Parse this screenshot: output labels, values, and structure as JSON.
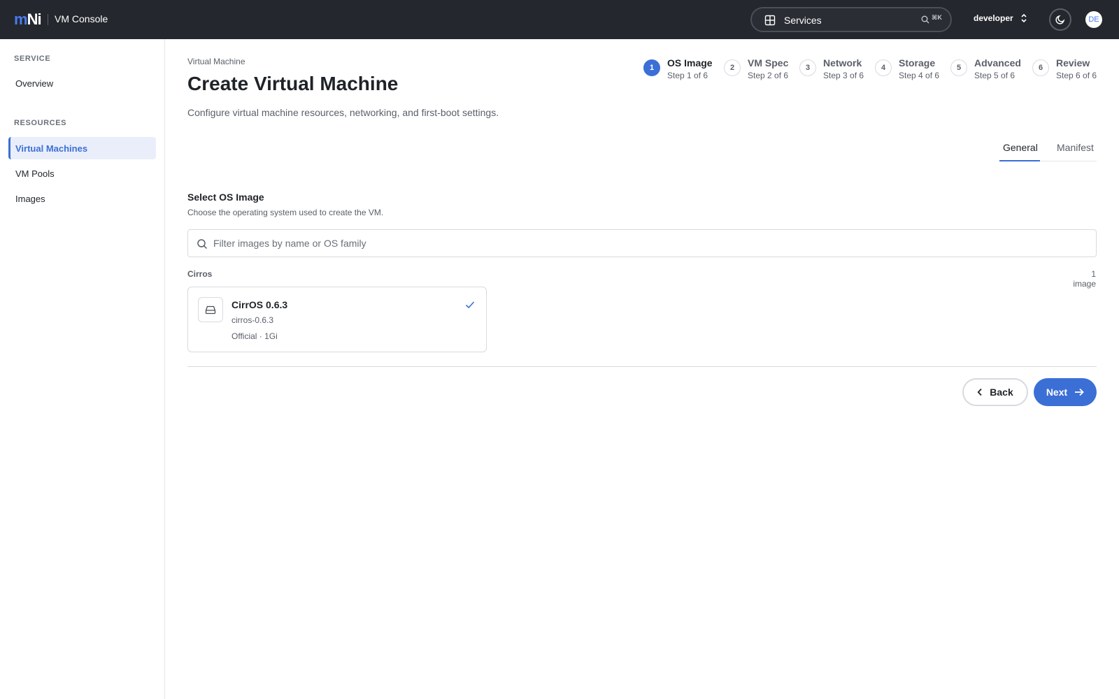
{
  "header": {
    "logo_m": "m",
    "logo_ni": "Ni",
    "app_title": "VM Console",
    "services_label": "Services",
    "shortcut": "⌘K",
    "project": "developer",
    "avatar_initials": "DE",
    "brand_color": "#4a7bf0"
  },
  "sidebar": {
    "sections": [
      {
        "title": "SERVICE",
        "items": [
          {
            "label": "Overview",
            "active": false
          }
        ]
      },
      {
        "title": "RESOURCES",
        "items": [
          {
            "label": "Virtual Machines",
            "active": true
          },
          {
            "label": "VM Pools",
            "active": false
          },
          {
            "label": "Images",
            "active": false
          }
        ]
      }
    ]
  },
  "page": {
    "breadcrumb": "Virtual Machine",
    "title": "Create Virtual Machine",
    "description": "Configure virtual machine resources, networking, and first-boot settings."
  },
  "stepper": {
    "active_step": 1,
    "steps": [
      {
        "num": "1",
        "title": "OS Image",
        "sub": "Step 1 of 6"
      },
      {
        "num": "2",
        "title": "VM Spec",
        "sub": "Step 2 of 6"
      },
      {
        "num": "3",
        "title": "Network",
        "sub": "Step 3 of 6"
      },
      {
        "num": "4",
        "title": "Storage",
        "sub": "Step 4 of 6"
      },
      {
        "num": "5",
        "title": "Advanced",
        "sub": "Step 5 of 6"
      },
      {
        "num": "6",
        "title": "Review",
        "sub": "Step 6 of 6"
      }
    ]
  },
  "tabs": {
    "general": "General",
    "manifest": "Manifest",
    "active": "General"
  },
  "os_section": {
    "title": "Select OS Image",
    "description": "Choose the operating system used to create the VM.",
    "filter_placeholder": "Filter images by name or OS family",
    "filter_value": "",
    "group_label": "Cirros",
    "group_count": "1 image",
    "image": {
      "name": "CirrOS 0.6.3",
      "id": "cirros-0.6.3",
      "meta": "Official · 1Gi",
      "selected": true
    }
  },
  "actions": {
    "back": "Back",
    "next": "Next"
  }
}
